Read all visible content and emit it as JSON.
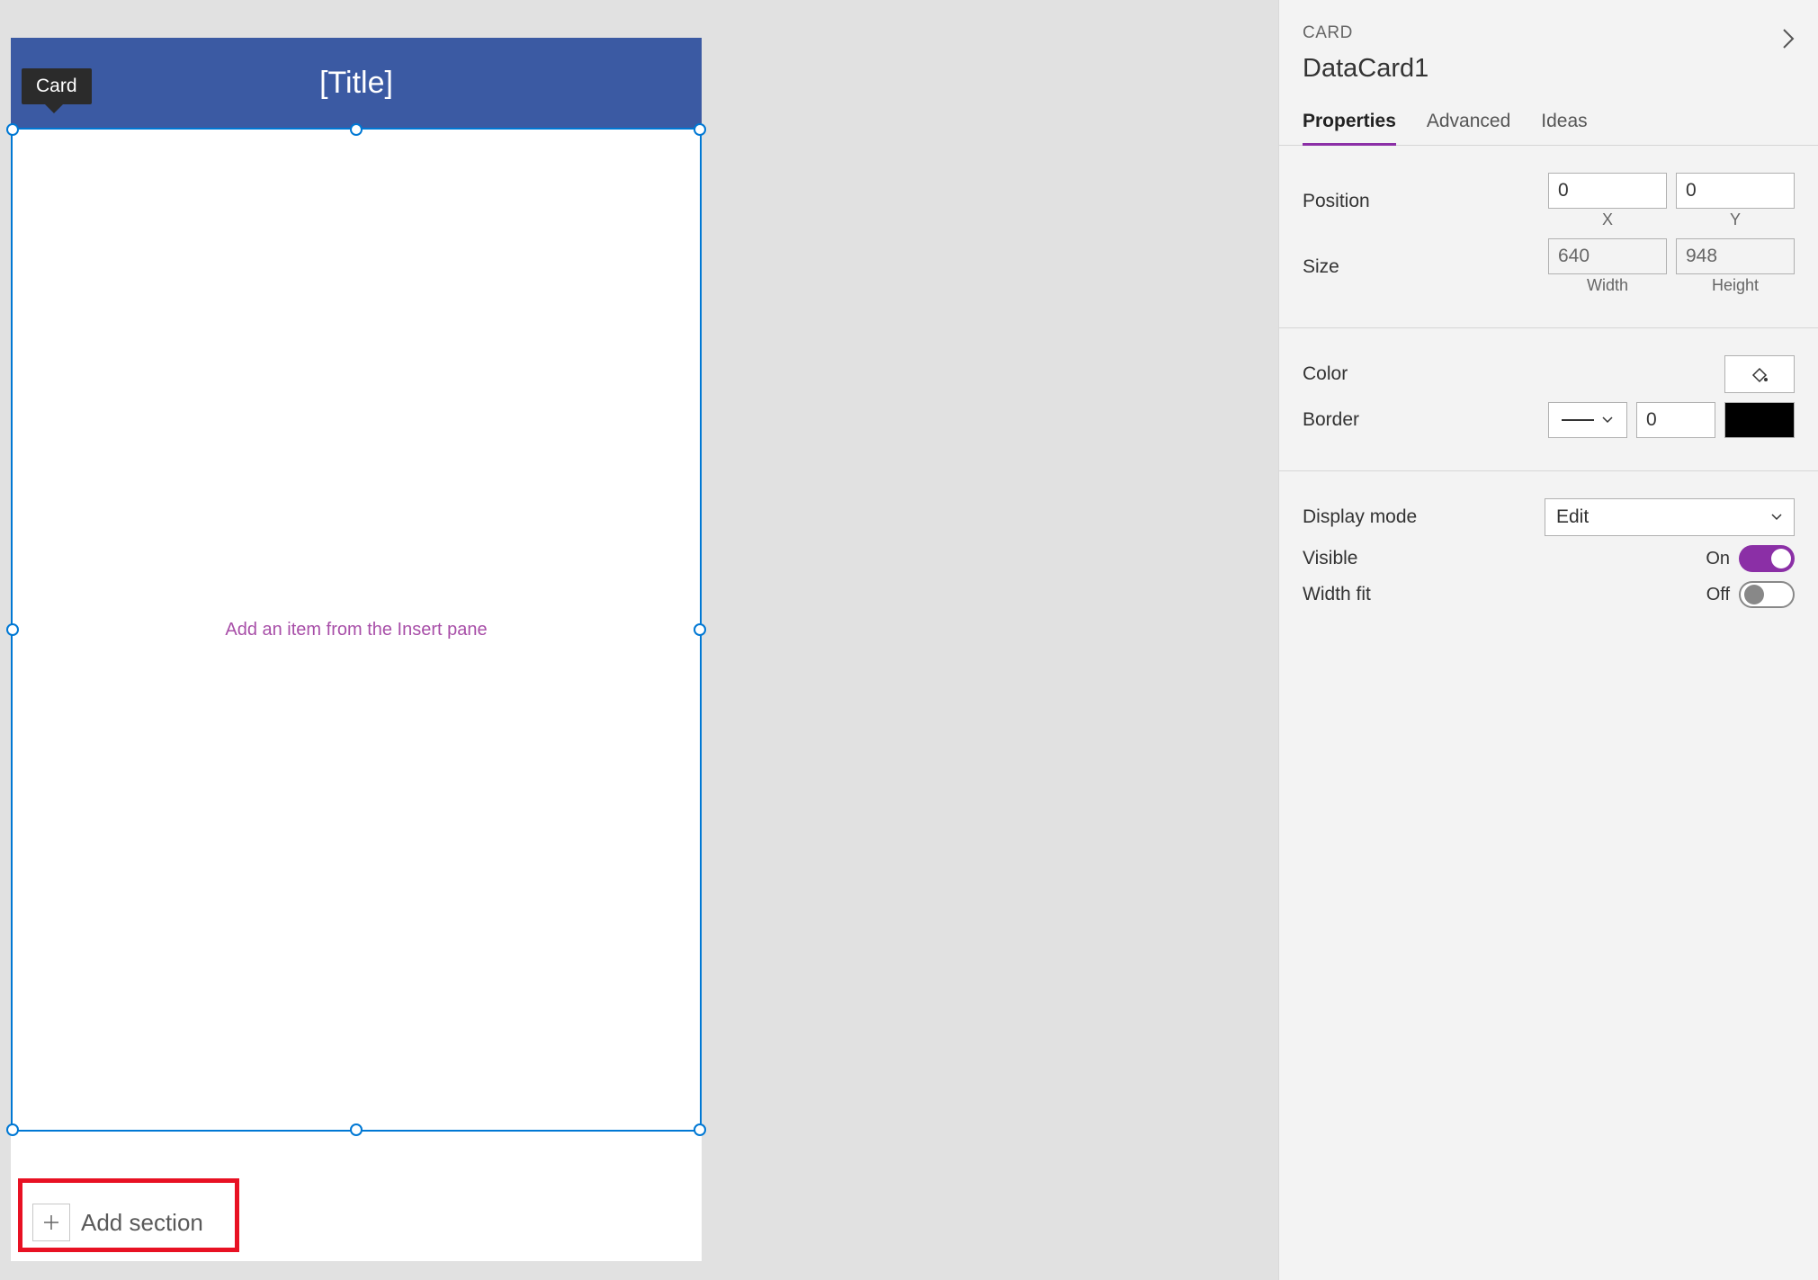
{
  "canvas": {
    "tooltip": "Card",
    "card_title": "[Title]",
    "body_hint": "Add an item from the Insert pane",
    "add_section_label": "Add section"
  },
  "panel": {
    "kind_label": "CARD",
    "object_name": "DataCard1",
    "tabs": {
      "properties": "Properties",
      "advanced": "Advanced",
      "ideas": "Ideas"
    },
    "position": {
      "label": "Position",
      "x": "0",
      "y": "0",
      "x_label": "X",
      "y_label": "Y"
    },
    "size": {
      "label": "Size",
      "width": "640",
      "height": "948",
      "width_label": "Width",
      "height_label": "Height"
    },
    "color": {
      "label": "Color"
    },
    "border": {
      "label": "Border",
      "width_value": "0"
    },
    "display_mode": {
      "label": "Display mode",
      "value": "Edit"
    },
    "visible": {
      "label": "Visible",
      "state": "On"
    },
    "width_fit": {
      "label": "Width fit",
      "state": "Off"
    }
  }
}
